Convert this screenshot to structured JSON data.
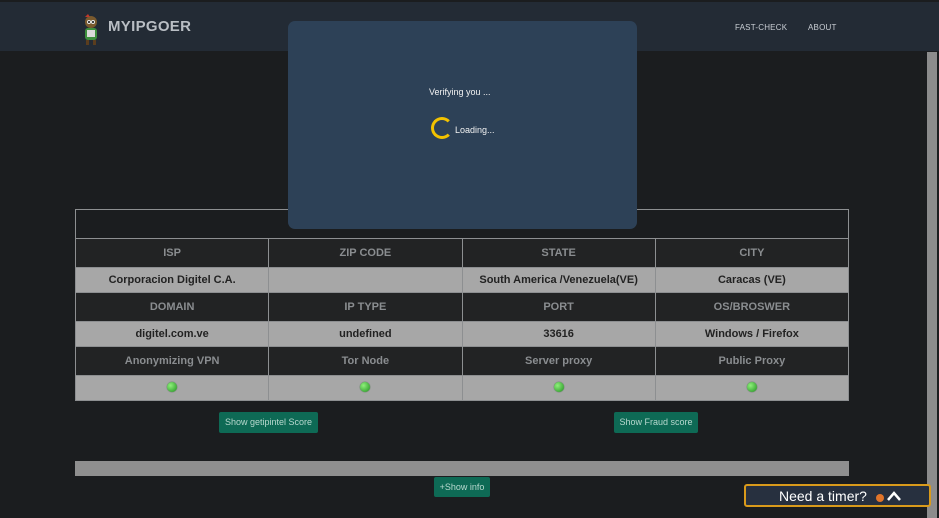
{
  "brand": {
    "name": "MYIPGOER"
  },
  "nav": {
    "fast_check": "FAST-CHECK",
    "about": "ABOUT"
  },
  "modal": {
    "verifying": "Verifying you ...",
    "loading": "Loading..."
  },
  "table": {
    "rows": [
      {
        "headers": [
          "ISP",
          "ZIP CODE",
          "STATE",
          "CITY"
        ],
        "values": [
          "Corporacion Digitel C.A.",
          "",
          "South America /Venezuela(VE)",
          "Caracas (VE)"
        ]
      },
      {
        "headers": [
          "DOMAIN",
          "IP TYPE",
          "PORT",
          "OS/BROSWER"
        ],
        "values": [
          "digitel.com.ve",
          "undefined",
          "33616",
          "Windows / Firefox"
        ]
      },
      {
        "headers": [
          "Anonymizing VPN",
          "Tor Node",
          "Server proxy",
          "Public Proxy"
        ],
        "status": [
          "green",
          "green",
          "green",
          "green"
        ]
      }
    ]
  },
  "buttons": {
    "getip_score": "Show getipintel Score",
    "fraud_score": "Show Fraud score",
    "show_info": "+Show info"
  },
  "timer": {
    "label": "Need a timer?"
  },
  "colors": {
    "accent": "#0e6a55",
    "status_ok": "#3cc43c",
    "timer_border": "#d99a1b",
    "spinner": "#f2c200"
  }
}
